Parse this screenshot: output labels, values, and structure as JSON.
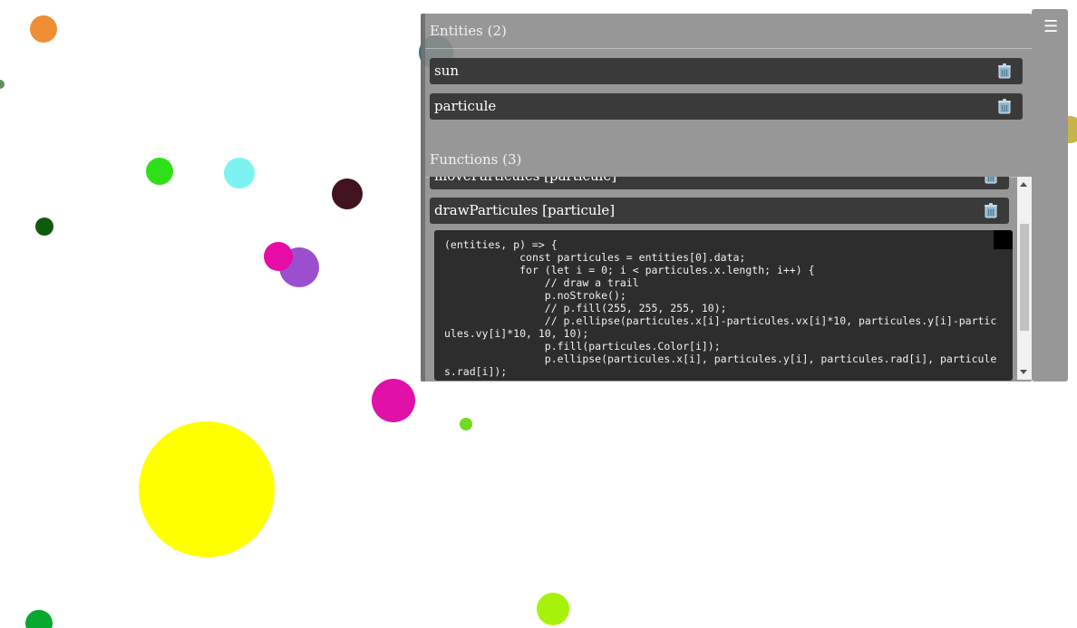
{
  "entities": {
    "title": "Entities (2)",
    "items": [
      {
        "label": "sun"
      },
      {
        "label": "particule"
      }
    ]
  },
  "functions": {
    "title": "Functions (3)",
    "items": [
      {
        "label": "moveParticules [particule]"
      },
      {
        "label": "drawParticules [particule]"
      }
    ],
    "code": "(entities, p) => {\n            const particules = entities[0].data;\n            for (let i = 0; i < particules.x.length; i++) {\n                // draw a trail\n                p.noStroke();\n                // p.fill(255, 255, 255, 10);\n                // p.ellipse(particules.x[i]-particules.vx[i]*10, particules.y[i]-particules.vy[i]*10, 10, 10);\n                p.fill(particules.Color[i]);\n                p.ellipse(particules.x[i], particules.y[i], particules.rad[i], particules.rad[i]);"
  },
  "menu": {
    "icon": "hamburger-icon",
    "glyph": "☰"
  },
  "icons": {
    "delete": "trash-icon"
  },
  "colors": {
    "panel_bg": "#8c8c8c",
    "item_bg": "#3a3a3a",
    "code_bg": "#2d2d2d"
  },
  "particles": [
    {
      "color": "#ef8e35"
    },
    {
      "color": "#5e8f5f"
    },
    {
      "color": "#2fdf18"
    },
    {
      "color": "#7df3f1"
    },
    {
      "color": "#41131f"
    },
    {
      "color": "#0f5a0d"
    },
    {
      "color": "#9b4fcf"
    },
    {
      "color": "#e70ca6"
    },
    {
      "color": "#2c6f86"
    },
    {
      "color": "#c8b34c"
    },
    {
      "color": "#e010a8"
    },
    {
      "color": "#70dc20"
    },
    {
      "color": "#ffff00"
    },
    {
      "color": "#07a92e"
    },
    {
      "color": "#a6f20a"
    }
  ]
}
